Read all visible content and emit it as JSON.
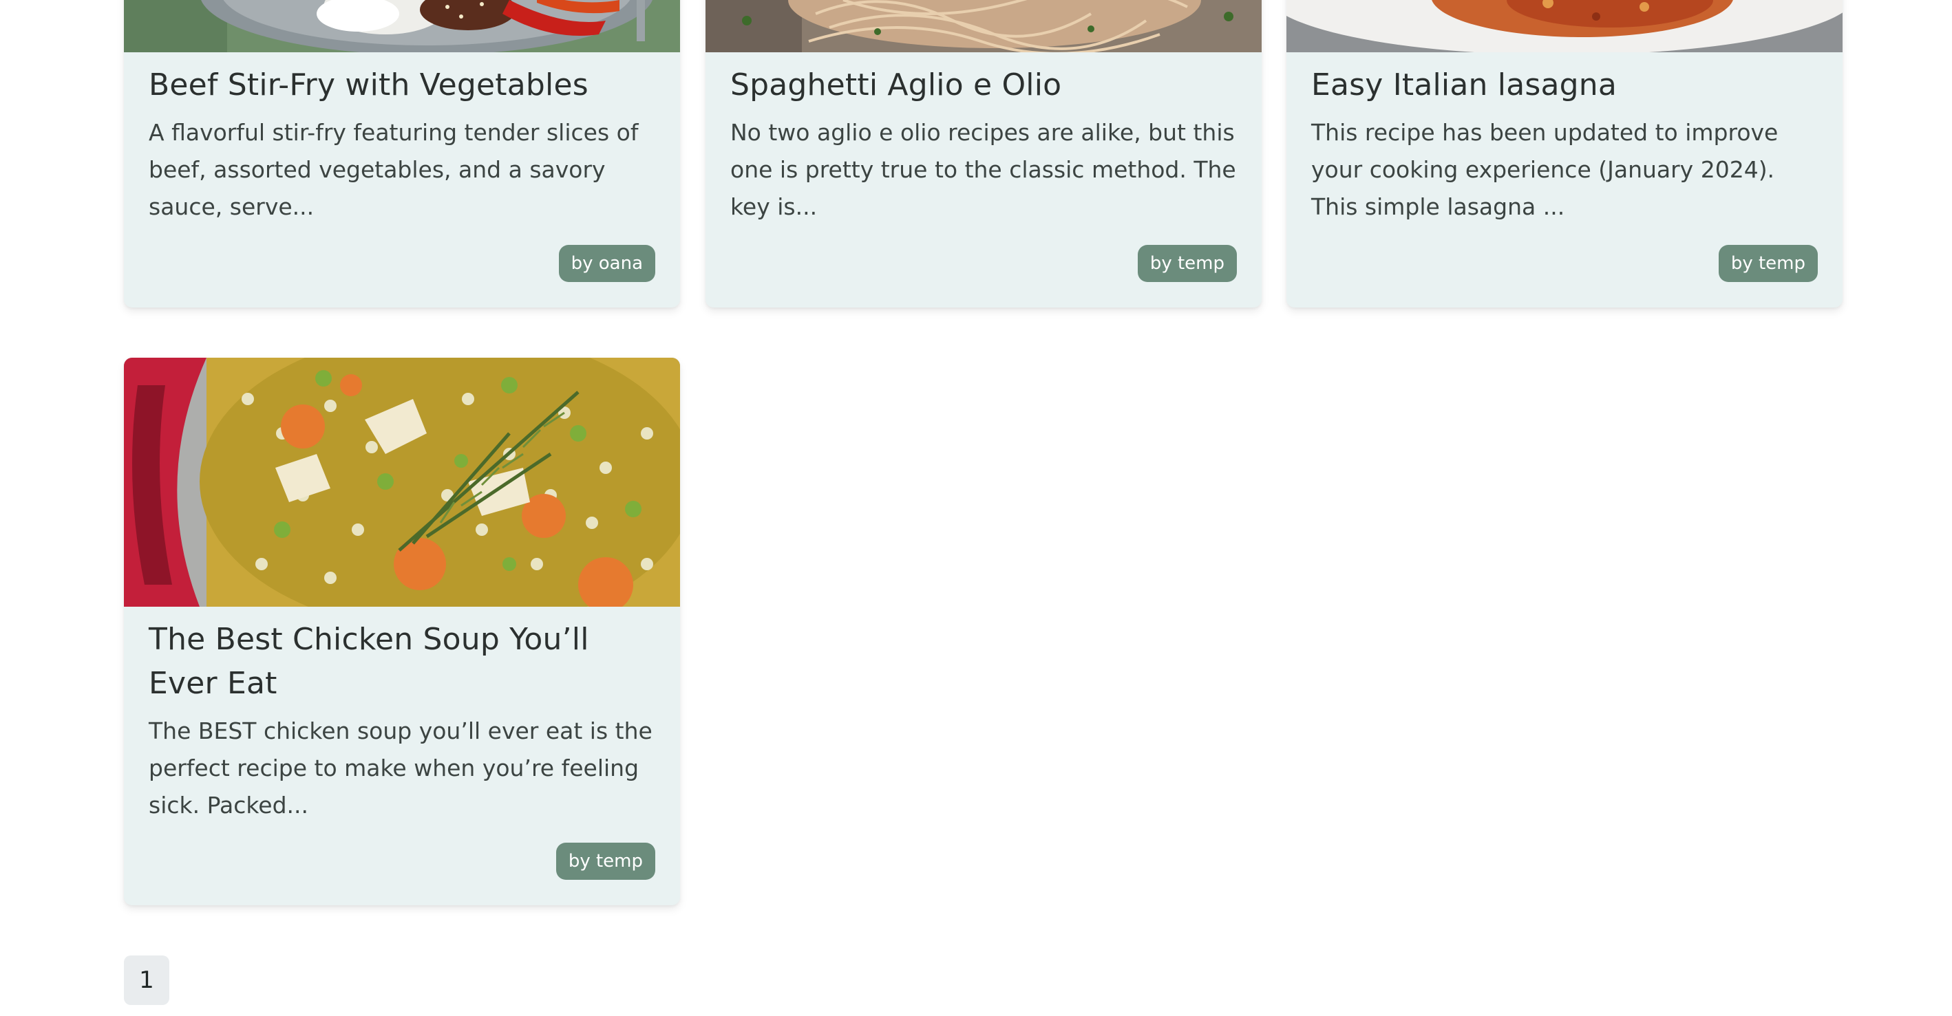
{
  "recipes": [
    {
      "title": "Beef Stir-Fry with Vegetables",
      "description": "A flavorful stir-fry featuring tender slices of beef, assorted vegetables, and a savory sauce, serve...",
      "author": "by oana"
    },
    {
      "title": "Spaghetti Aglio e Olio",
      "description": "No two aglio e olio recipes are alike, but this one is pretty true to the classic method. The key is...",
      "author": "by temp"
    },
    {
      "title": "Easy Italian lasagna",
      "description": "This recipe has been updated to improve your cooking experience (January 2024). This simple lasagna ...",
      "author": "by temp"
    },
    {
      "title": "The Best Chicken Soup You’ll Ever Eat",
      "description": "The BEST chicken soup you’ll ever eat is the perfect recipe to make when you’re feeling sick. Packed...",
      "author": "by temp"
    }
  ],
  "pagination": {
    "current_page": "1"
  },
  "colors": {
    "card_background": "#e9f2f2",
    "badge_background": "#6b8c7c",
    "pager_background": "#e9ecee"
  }
}
